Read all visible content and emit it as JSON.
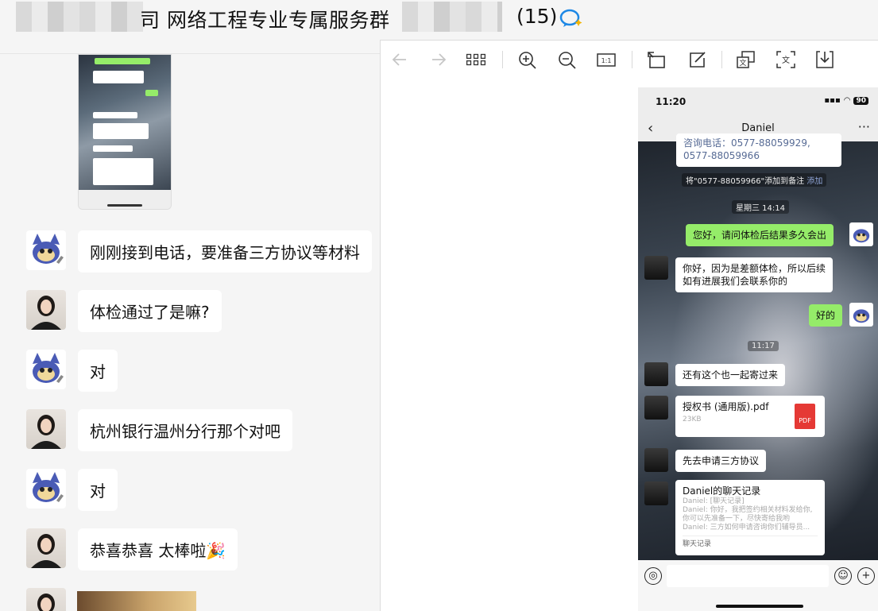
{
  "window": {
    "title": "司 网络工程专业专属服务群",
    "member_count": "(15)"
  },
  "chat": {
    "messages": [
      {
        "sender": "cat",
        "text": "刚刚接到电话，要准备三方协议等材料"
      },
      {
        "sender": "woman",
        "text": "体检通过了是嘛?"
      },
      {
        "sender": "cat",
        "text": "对"
      },
      {
        "sender": "woman",
        "text": "杭州银行温州分行那个对吧"
      },
      {
        "sender": "cat",
        "text": "对"
      },
      {
        "sender": "woman",
        "text": "恭喜恭喜 太棒啦🎉"
      }
    ]
  },
  "viewer": {
    "toolbar": [
      "back-arrow",
      "forward-arrow",
      "grid-view",
      "zoom-in",
      "zoom-out",
      "actual-size",
      "rotate",
      "edit",
      "translate",
      "extract-text",
      "download"
    ]
  },
  "phone": {
    "time": "11:20",
    "battery": "90",
    "contact_name": "Daniel",
    "top_partial_line1": "咨询电话：0577-88059929,",
    "top_partial_line2": "0577-88059966",
    "sys_add_note": "将\"0577-88059966\"添加到备注",
    "sys_add_link": "添加",
    "timestamp1": "星期三 14:14",
    "msg_question": "您好，请问体检后结果多久会出",
    "msg_reply_line1": "你好，因为是差额体检，所以后续",
    "msg_reply_line2": "如有进展我们会联系你的",
    "msg_ok": "好的",
    "timestamp2": "11:17",
    "msg_send_together": "还有这个也一起寄过来",
    "file_name": "授权书 (通用版).pdf",
    "file_size": "23KB",
    "file_icon": "PDF",
    "msg_apply": "先去申请三方协议",
    "record_title": "Daniel的聊天记录",
    "record_line1": "Daniel: [聊天记录]",
    "record_line2": "Daniel: 你好，我把签约相关材料发给你,",
    "record_line3": "你可以先准备一下，尽快寄给我哟",
    "record_line4": "Daniel: 三方如何申请咨询你们辅导员...",
    "record_footer": "聊天记录"
  }
}
